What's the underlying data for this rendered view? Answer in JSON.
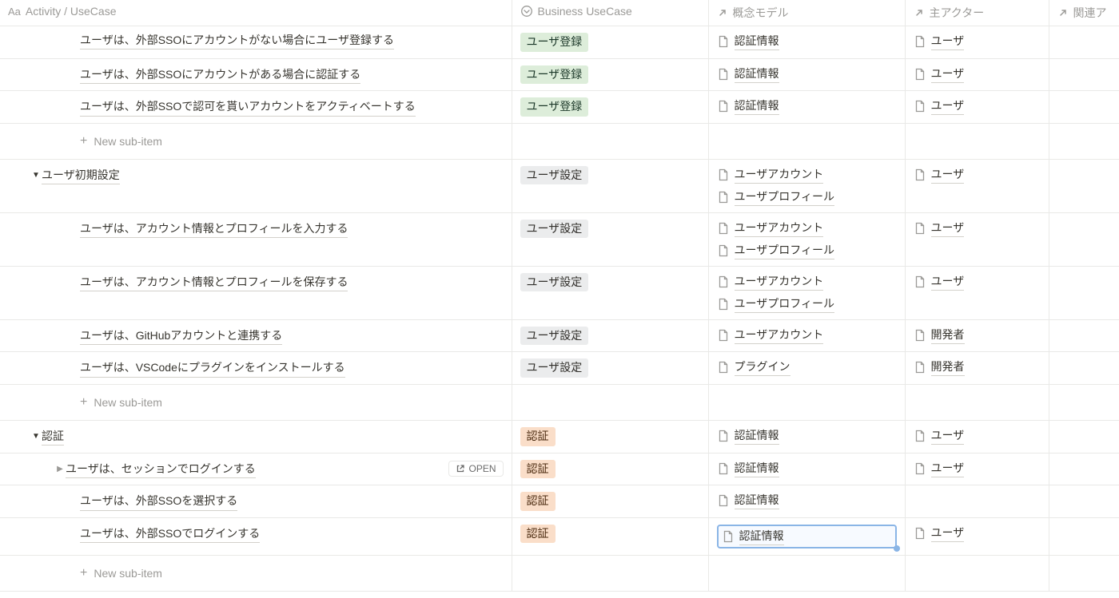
{
  "headers": {
    "activity": "Activity / UseCase",
    "business_usecase": "Business UseCase",
    "concept_model": "概念モデル",
    "main_actor": "主アクター",
    "related_a": "関連ア"
  },
  "badges": {
    "user_register": "ユーザ登録",
    "user_setting": "ユーザ設定",
    "auth": "認証"
  },
  "links": {
    "auth_info": "認証情報",
    "user": "ユーザ",
    "user_account": "ユーザアカウント",
    "user_profile": "ユーザプロフィール",
    "developer": "開発者",
    "plugin": "プラグイン"
  },
  "new_sub_item": "New sub-item",
  "open_label": "OPEN",
  "groups": [
    {
      "rows": [
        {
          "title": "ユーザは、外部SSOにアカウントがない場合にユーザ登録する",
          "badge": "user_register",
          "badgeClass": "green",
          "concepts": [
            "auth_info"
          ],
          "actors": [
            "user"
          ],
          "cut": true
        },
        {
          "title": "ユーザは、外部SSOにアカウントがある場合に認証する",
          "badge": "user_register",
          "badgeClass": "green",
          "concepts": [
            "auth_info"
          ],
          "actors": [
            "user"
          ]
        },
        {
          "title": "ユーザは、外部SSOで認可を貰いアカウントをアクティベートする",
          "badge": "user_register",
          "badgeClass": "green",
          "concepts": [
            "auth_info"
          ],
          "actors": [
            "user"
          ]
        }
      ]
    },
    {
      "header": {
        "title": "ユーザ初期設定",
        "badge": "user_setting",
        "badgeClass": "gray",
        "concepts": [
          "user_account",
          "user_profile"
        ],
        "actors": [
          "user"
        ]
      },
      "rows": [
        {
          "title": "ユーザは、アカウント情報とプロフィールを入力する",
          "badge": "user_setting",
          "badgeClass": "gray",
          "concepts": [
            "user_account",
            "user_profile"
          ],
          "actors": [
            "user"
          ]
        },
        {
          "title": "ユーザは、アカウント情報とプロフィールを保存する",
          "badge": "user_setting",
          "badgeClass": "gray",
          "concepts": [
            "user_account",
            "user_profile"
          ],
          "actors": [
            "user"
          ]
        },
        {
          "title": "ユーザは、GitHubアカウントと連携する",
          "badge": "user_setting",
          "badgeClass": "gray",
          "concepts": [
            "user_account"
          ],
          "actors": [
            "developer"
          ]
        },
        {
          "title": "ユーザは、VSCodeにプラグインをインストールする",
          "badge": "user_setting",
          "badgeClass": "gray",
          "concepts": [
            "plugin"
          ],
          "actors": [
            "developer"
          ]
        }
      ]
    },
    {
      "header": {
        "title": "認証",
        "badge": "auth",
        "badgeClass": "orange",
        "concepts": [
          "auth_info"
        ],
        "actors": [
          "user"
        ]
      },
      "rows": [
        {
          "title": "ユーザは、セッションでログインする",
          "badge": "auth",
          "badgeClass": "orange",
          "concepts": [
            "auth_info"
          ],
          "actors": [
            "user"
          ],
          "hover": true,
          "toggle": "right"
        },
        {
          "title": "ユーザは、外部SSOを選択する",
          "badge": "auth",
          "badgeClass": "orange",
          "concepts": [
            "auth_info"
          ],
          "actors": []
        },
        {
          "title": "ユーザは、外部SSOでログインする",
          "badge": "auth",
          "badgeClass": "orange",
          "concepts": [
            "auth_info"
          ],
          "actors": [
            "user"
          ],
          "conceptSelected": true
        }
      ]
    }
  ]
}
